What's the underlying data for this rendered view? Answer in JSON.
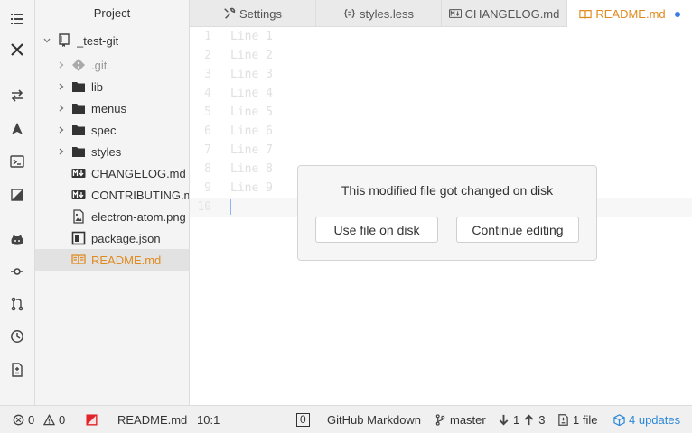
{
  "tree_view": {
    "title": "Project",
    "root": "_test-git",
    "items": [
      {
        "label": ".git",
        "kind": "folder",
        "state": "ignored"
      },
      {
        "label": "lib",
        "kind": "folder"
      },
      {
        "label": "menus",
        "kind": "folder"
      },
      {
        "label": "spec",
        "kind": "folder"
      },
      {
        "label": "styles",
        "kind": "folder"
      },
      {
        "label": "CHANGELOG.md",
        "kind": "markdown"
      },
      {
        "label": "CONTRIBUTING.md",
        "kind": "markdown"
      },
      {
        "label": "electron-atom.png",
        "kind": "image"
      },
      {
        "label": "package.json",
        "kind": "json"
      },
      {
        "label": "README.md",
        "kind": "readme",
        "selected": true
      }
    ]
  },
  "tabs": [
    {
      "label": "Settings",
      "icon": "wrench-icon"
    },
    {
      "label": "styles.less",
      "icon": "file-code-icon"
    },
    {
      "label": "CHANGELOG.md",
      "icon": "markdown-icon"
    },
    {
      "label": "README.md",
      "icon": "book-icon",
      "active": true,
      "modified": true
    }
  ],
  "editor": {
    "line_numbers": [
      "1",
      "2",
      "3",
      "4",
      "5",
      "6",
      "7",
      "8",
      "9",
      "10"
    ],
    "lines": [
      "Line 1",
      "Line 2",
      "Line 3",
      "Line 4",
      "Line 5",
      "Line 6",
      "Line 7",
      "Line 8",
      "Line 9",
      ""
    ]
  },
  "notification": {
    "message": "This modified file got changed on disk",
    "use_disk_label": "Use file on disk",
    "continue_label": "Continue editing"
  },
  "status_bar": {
    "errors": "0",
    "warnings": "0",
    "file_name": "README.md",
    "cursor_position": "10:1",
    "encoding_box": "0",
    "grammar": "GitHub Markdown",
    "branch": "master",
    "behind_ahead": "1",
    "ahead": "3",
    "changed_files": "1 file",
    "updates": "4 updates"
  },
  "colors": {
    "accent_orange": "#e08a1e",
    "accent_blue": "#2d88d8",
    "error_red": "#e0242a"
  }
}
